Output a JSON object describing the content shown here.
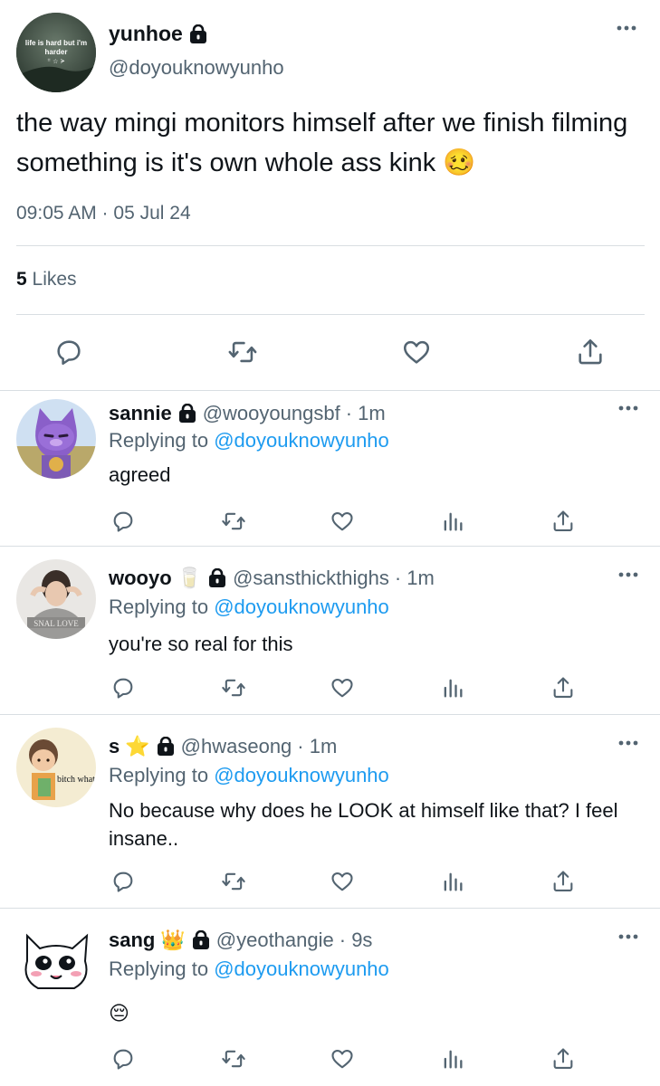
{
  "main_tweet": {
    "avatar_text": [
      "life is hard but i'm",
      "harder",
      "ꜝꜝ ☆ ᗒ"
    ],
    "display_name": "yunhoe",
    "handle": "@doyouknowyunho",
    "text": "the way mingi monitors himself after we finish filming something is it's own whole ass kink 🥴",
    "timestamp": "09:05 AM · 05 Jul 24",
    "likes_count": "5",
    "likes_label": "Likes"
  },
  "replies": [
    {
      "display_name": "sannie",
      "name_emoji": "",
      "handle": "@wooyoungsbf",
      "time": "· 1m",
      "replying_prefix": "Replying to",
      "mention": "@doyouknowyunho",
      "text": "agreed"
    },
    {
      "display_name": "wooyo",
      "name_emoji": "🥛",
      "handle": "@sansthickthighs",
      "time": "· 1m",
      "replying_prefix": "Replying to",
      "mention": "@doyouknowyunho",
      "text": "you're so real for this"
    },
    {
      "display_name": "s",
      "name_emoji": "⭐",
      "handle": "@hwaseong",
      "time": "· 1m",
      "replying_prefix": "Replying to",
      "mention": "@doyouknowyunho",
      "text": "No because why does he LOOK at himself like that? I feel insane..",
      "avatar_caption": "bitch what"
    },
    {
      "display_name": "sang",
      "name_emoji": "👑",
      "handle": "@yeothangie",
      "time": "· 9s",
      "replying_prefix": "Replying to",
      "mention": "@doyouknowyunho",
      "text": "😔"
    }
  ],
  "colors": {
    "text": "#0f1419",
    "secondary": "#536471",
    "link": "#1d9bf0",
    "divider": "#d9dee2"
  },
  "icons": [
    "lock-icon",
    "more-icon",
    "reply-icon",
    "retweet-icon",
    "like-icon",
    "views-icon",
    "share-icon"
  ]
}
